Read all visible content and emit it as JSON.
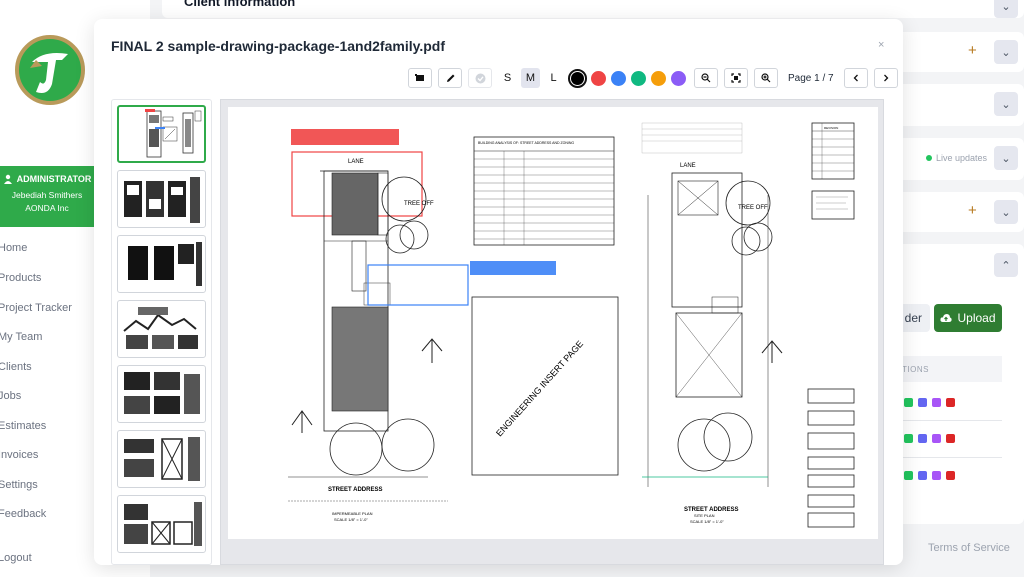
{
  "sidebar": {
    "role": "ADMINISTRATOR",
    "user_name": "Jebediah Smithers",
    "company": "AONDA Inc",
    "nav": [
      "Home",
      "Products",
      "Project Tracker",
      "My Team",
      "Clients",
      "Jobs",
      "Estimates",
      "Invoices",
      "Settings",
      "Feedback"
    ],
    "logout": "Logout"
  },
  "main": {
    "section_title": "Client information",
    "live_updates": "Live updates",
    "folder_label": "der",
    "upload_label": "Upload",
    "actions_header": "TIONS",
    "footer_link": "Terms of Service"
  },
  "modal": {
    "title": "FINAL 2 sample-drawing-package-1and2family.pdf",
    "close": "×",
    "sizes": [
      "S",
      "M",
      "L"
    ],
    "active_size": "M",
    "colors": [
      "#000000",
      "#ef4444",
      "#3b82f6",
      "#10b981",
      "#f59e0b",
      "#8b5cf6"
    ],
    "page_indicator": "Page 1 / 7",
    "thumbnail_count": 7
  },
  "drawing": {
    "lane": "LANE",
    "street_address": "STREET ADDRESS",
    "engineering": "ENGINEERING INSERT PAGE",
    "impermeable_plan": "IMPERMEABLE PLAN",
    "site_plan": "SITE PLAN",
    "scale": "SCALE 1/8\" = 1'-0\"",
    "building_analysis": "BUILDING ANALYSIS OF:     STREET ADDRESS AND ZONING",
    "revision": "REVISION",
    "tree_a": "TREE\nOFF",
    "tree_b": "TREE\nOFF"
  }
}
